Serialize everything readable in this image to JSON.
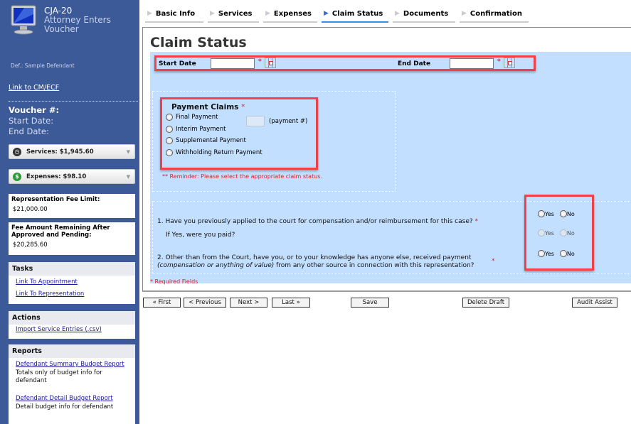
{
  "sidebar": {
    "app_code": "CJA-20",
    "app_subtitle_1": "Attorney Enters",
    "app_subtitle_2": "Voucher",
    "defendant": "Def.: Sample Defendant",
    "cmecf_link": "Link to CM/ECF",
    "voucher_label": "Voucher #:",
    "start_date_label": "Start Date:",
    "end_date_label": "End Date:",
    "services_dropdown": {
      "icon": "clock-icon",
      "label": "Services: $1,945.60"
    },
    "expenses_dropdown": {
      "icon": "dollar-icon",
      "label": "Expenses: $98.10"
    },
    "fee_limit": {
      "label": "Representation Fee Limit:",
      "value": "$21,000.00"
    },
    "fee_remaining": {
      "label": "Fee Amount Remaining After Approved and Pending:",
      "value": "$20,285.60"
    },
    "tasks": {
      "title": "Tasks",
      "links": [
        "Link To Appointment",
        "Link To Representation"
      ]
    },
    "actions": {
      "title": "Actions",
      "links": [
        "Import Service Entries (.csv)"
      ]
    },
    "reports": {
      "title": "Reports",
      "items": [
        {
          "link": "Defendant Summary Budget Report",
          "desc": "Totals only of budget info for defendant"
        },
        {
          "link": "Defendant Detail Budget Report",
          "desc": "Detail budget info for defendant"
        }
      ]
    }
  },
  "tabs": [
    {
      "label": "Basic Info",
      "active": false
    },
    {
      "label": "Services",
      "active": false
    },
    {
      "label": "Expenses",
      "active": false
    },
    {
      "label": "Claim Status",
      "active": true
    },
    {
      "label": "Documents",
      "active": false
    },
    {
      "label": "Confirmation",
      "active": false
    }
  ],
  "main": {
    "title": "Claim Status",
    "start_date": {
      "label": "Start Date",
      "value": "",
      "required": "*"
    },
    "end_date": {
      "label": "End Date",
      "value": "",
      "required": "*"
    },
    "payment_claims": {
      "title": "Payment Claims",
      "required": "*",
      "options": [
        "Final Payment",
        "Interim Payment",
        "Supplemental Payment",
        "Withholding Return Payment"
      ],
      "payment_number_value": "",
      "payment_number_label": "(payment #)",
      "reminder": "** Reminder: Please select the appropriate claim status."
    },
    "questions": {
      "q1": "1. Have you previously applied to the court for compensation and/or reimbursement for this case?",
      "q1_sub": "If Yes, were you paid?",
      "q2_line1": "2. Other than from the Court, have you, or to your knowledge has anyone else, received payment",
      "q2_italic": "(compensation or anything of value)",
      "q2_line2": " from any other source in connection with this representation?",
      "required": "*",
      "yes": "Yes",
      "no": "No"
    },
    "required_note": "* Required Fields"
  },
  "buttons": {
    "first": "« First",
    "previous": "< Previous",
    "next": "Next >",
    "last": "Last »",
    "save": "Save",
    "delete_draft": "Delete Draft",
    "audit_assist": "Audit Assist"
  }
}
